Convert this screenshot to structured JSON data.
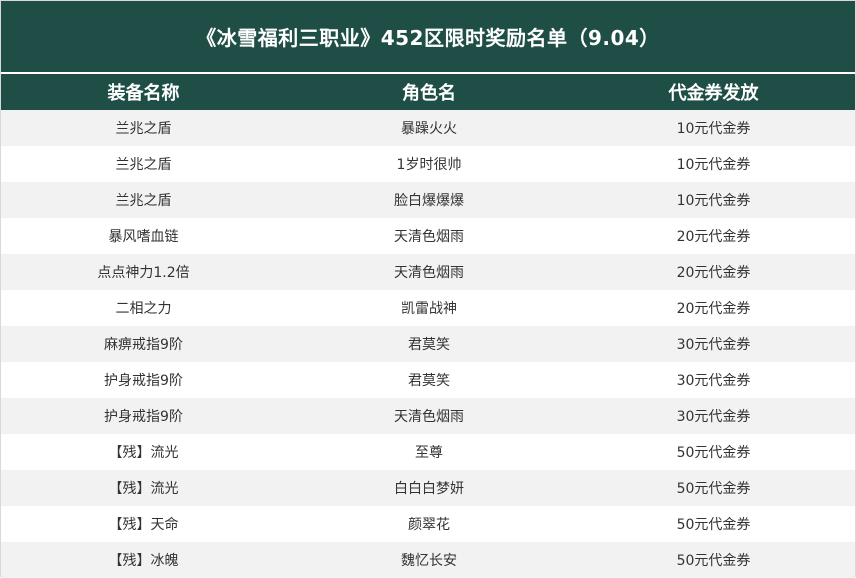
{
  "title": "《冰雪福利三职业》452区限时奖励名单（9.04）",
  "colors": {
    "header_bg": "#1f4e46",
    "header_text": "#ffffff",
    "row_shade": "#f2f2f2",
    "row_plain": "#ffffff",
    "cell_text": "#333333"
  },
  "table": {
    "headers": [
      "装备名称",
      "角色名",
      "代金券发放"
    ],
    "rows": [
      [
        "兰兆之盾",
        "暴躁火火",
        "10元代金券"
      ],
      [
        "兰兆之盾",
        "1岁时很帅",
        "10元代金券"
      ],
      [
        "兰兆之盾",
        "脸白爆爆爆",
        "10元代金券"
      ],
      [
        "暴风嗜血链",
        "天清色烟雨",
        "20元代金券"
      ],
      [
        "点点神力1.2倍",
        "天清色烟雨",
        "20元代金券"
      ],
      [
        "二相之力",
        "凯雷战神",
        "20元代金券"
      ],
      [
        "麻痹戒指9阶",
        "君莫笑",
        "30元代金券"
      ],
      [
        "护身戒指9阶",
        "君莫笑",
        "30元代金券"
      ],
      [
        "护身戒指9阶",
        "天清色烟雨",
        "30元代金券"
      ],
      [
        "【残】流光",
        "至尊",
        "50元代金券"
      ],
      [
        "【残】流光",
        "白白白梦妍",
        "50元代金券"
      ],
      [
        "【残】天命",
        "颜翠花",
        "50元代金券"
      ],
      [
        "【残】冰魄",
        "魏忆长安",
        "50元代金券"
      ]
    ]
  }
}
